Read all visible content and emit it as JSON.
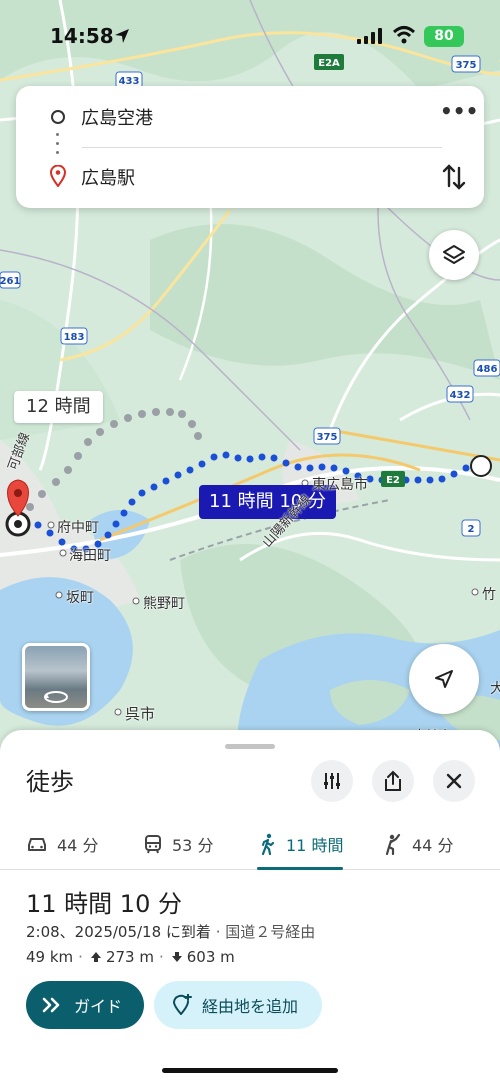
{
  "status_bar": {
    "time": "14:58",
    "battery": "80"
  },
  "search": {
    "origin": "広島空港",
    "destination": "広島駅"
  },
  "map": {
    "alt_route_time": "12 時間",
    "route_time": "11 時間 10 分",
    "places": {
      "fuchu": "府中町",
      "kaita": "海田町",
      "saka": "坂町",
      "kumano": "熊野町",
      "kure": "呉市",
      "higashihiroshima": "東広島市",
      "sanyo_shinkansen": "山陽新幹線",
      "kabe_line": "可部線",
      "takehara": "竹",
      "otake": "大",
      "ozaki": "大崎上"
    },
    "road_shields": {
      "e2a": "E2A",
      "e2": "E2",
      "r433": "433",
      "r375_top": "375",
      "r375": "375",
      "r183": "183",
      "r486": "486",
      "r432": "432",
      "r261": "261",
      "r2": "2"
    }
  },
  "panel": {
    "mode_title": "徒歩",
    "tabs": [
      {
        "id": "car",
        "label": "44 分"
      },
      {
        "id": "transit",
        "label": "53 分"
      },
      {
        "id": "walk",
        "label": "11 時間"
      },
      {
        "id": "ride",
        "label": "44 分"
      }
    ],
    "duration": "11 時間 10 分",
    "arrival": "2:08、2025/05/18 に到着",
    "via": "国道２号経由",
    "distance": "49 km",
    "ascent": "273 m",
    "descent": "603 m",
    "guide_label": "ガイド",
    "add_stop_label": "経由地を追加"
  }
}
